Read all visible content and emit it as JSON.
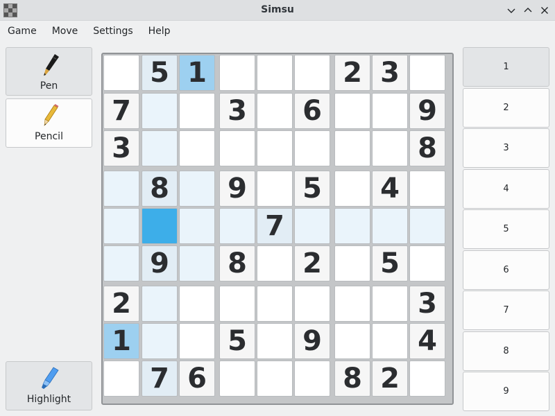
{
  "window": {
    "title": "Simsu"
  },
  "menu": [
    "Game",
    "Move",
    "Settings",
    "Help"
  ],
  "tools": {
    "pen": "Pen",
    "pencil": "Pencil",
    "highlight": "Highlight"
  },
  "board": {
    "grid": [
      [
        "",
        "5",
        "1",
        "",
        "",
        "",
        "2",
        "3",
        ""
      ],
      [
        "7",
        "",
        "",
        "3",
        "",
        "6",
        "",
        "",
        "9"
      ],
      [
        "3",
        "",
        "",
        "",
        "",
        "",
        "",
        "",
        "8"
      ],
      [
        "",
        "8",
        "",
        "9",
        "",
        "5",
        "",
        "4",
        ""
      ],
      [
        "",
        "",
        "",
        "",
        "7",
        "",
        "",
        "",
        ""
      ],
      [
        "",
        "9",
        "",
        "8",
        "",
        "2",
        "",
        "5",
        ""
      ],
      [
        "2",
        "",
        "",
        "",
        "",
        "",
        "",
        "",
        "3"
      ],
      [
        "1",
        "",
        "",
        "5",
        "",
        "9",
        "",
        "",
        "4"
      ],
      [
        "",
        "7",
        "6",
        "",
        "",
        "",
        "8",
        "2",
        ""
      ]
    ],
    "selected_cell": [
      4,
      1
    ],
    "active_number": "1"
  },
  "numbers": [
    "1",
    "2",
    "3",
    "4",
    "5",
    "6",
    "7",
    "8",
    "9"
  ],
  "colors": {
    "selection": "#3daee9",
    "match": "#9dd0f0",
    "related": "#eaf4fb"
  }
}
